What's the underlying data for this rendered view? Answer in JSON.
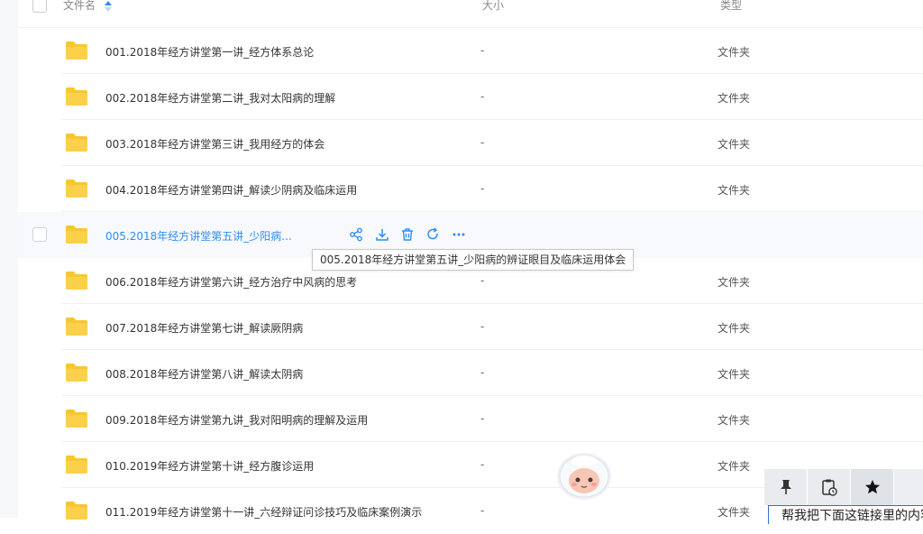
{
  "header": {
    "name_label": "文件名",
    "size_label": "大小",
    "type_label": "类型"
  },
  "files": [
    {
      "name": "001.2018年经方讲堂第一讲_经方体系总论",
      "size": "-",
      "type": "文件夹"
    },
    {
      "name": "002.2018年经方讲堂第二讲_我对太阳病的理解",
      "size": "-",
      "type": "文件夹"
    },
    {
      "name": "003.2018年经方讲堂第三讲_我用经方的体会",
      "size": "-",
      "type": "文件夹"
    },
    {
      "name": "004.2018年经方讲堂第四讲_解读少阴病及临床运用",
      "size": "-",
      "type": "文件夹"
    },
    {
      "name": "005.2018年经方讲堂第五讲_少阳病...",
      "size": "",
      "type": ""
    },
    {
      "name": "006.2018年经方讲堂第六讲_经方治疗中风病的思考",
      "size": "-",
      "type": "文件夹"
    },
    {
      "name": "007.2018年经方讲堂第七讲_解读厥阴病",
      "size": "-",
      "type": "文件夹"
    },
    {
      "name": "008.2018年经方讲堂第八讲_解读太阴病",
      "size": "-",
      "type": "文件夹"
    },
    {
      "name": "009.2018年经方讲堂第九讲_我对阳明病的理解及运用",
      "size": "-",
      "type": "文件夹"
    },
    {
      "name": "010.2019年经方讲堂第十讲_经方腹诊运用",
      "size": "-",
      "type": "文件夹"
    },
    {
      "name": "011.2019年经方讲堂第十一讲_六经辩证问诊技巧及临床案例演示",
      "size": "-",
      "type": "文件夹"
    }
  ],
  "tooltip": "005.2018年经方讲堂第五讲_少阳病的辨证眼目及临床运用体会",
  "hover_actions": [
    "share-icon",
    "download-icon",
    "delete-icon",
    "sync-icon",
    "more-icon"
  ],
  "toolbar": {
    "icons": [
      "pin-icon",
      "clipboard-clock-icon",
      "star-icon"
    ]
  },
  "input_peek": "帮我把下面这链接里的内容",
  "colors": {
    "accent": "#2f8ef7",
    "folder": "#f9c630",
    "folder_dark": "#f2b61c"
  }
}
